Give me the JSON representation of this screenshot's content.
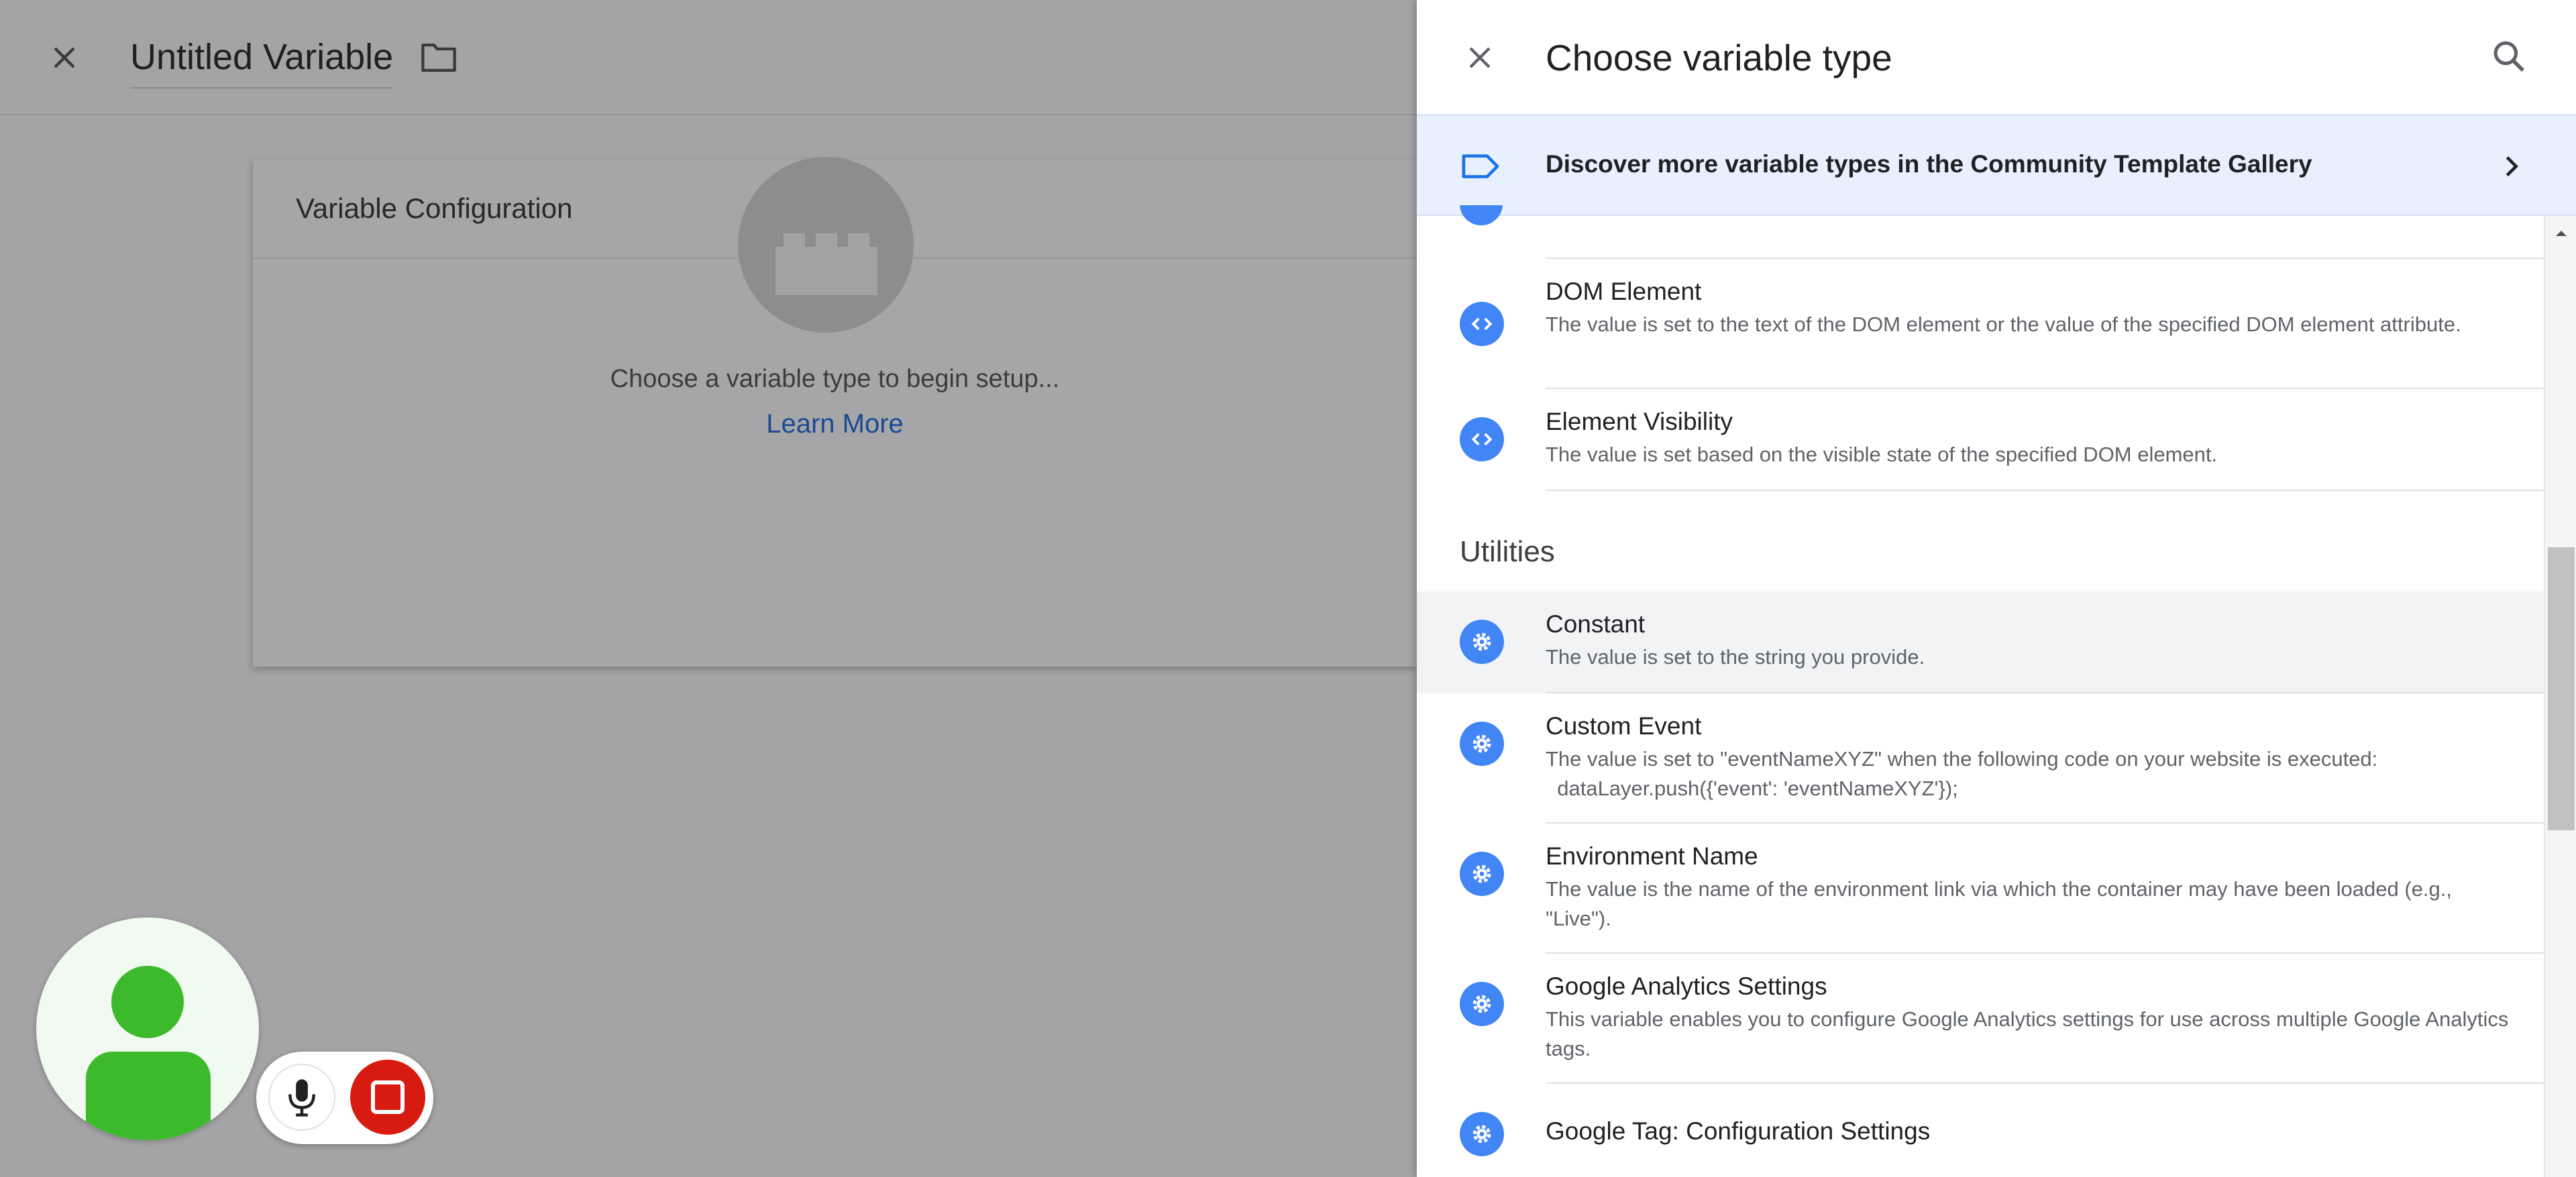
{
  "editor": {
    "title": "Untitled Variable",
    "config_card": {
      "heading": "Variable Configuration",
      "hint": "Choose a variable type to begin setup...",
      "learn_more": "Learn More"
    }
  },
  "drawer": {
    "title": "Choose variable type",
    "gallery_banner": "Discover more variable types in the Community Template Gallery",
    "page_elements_items": [
      {
        "name": "DOM Element",
        "desc": "The value is set to the text of the DOM element or the value of the specified DOM element attribute.",
        "icon": "code-icon"
      },
      {
        "name": "Element Visibility",
        "desc": "The value is set based on the visible state of the specified DOM element.",
        "icon": "code-icon"
      }
    ],
    "utilities_header": "Utilities",
    "utilities_items": [
      {
        "name": "Constant",
        "desc": "The value is set to the string you provide.",
        "icon": "gear-icon"
      },
      {
        "name": "Custom Event",
        "desc": "The value is set to \"eventNameXYZ\" when the following code on your website is executed:\n  dataLayer.push({'event': 'eventNameXYZ'});",
        "icon": "gear-icon"
      },
      {
        "name": "Environment Name",
        "desc": "The value is the name of the environment link via which the container may have been loaded (e.g., \"Live\").",
        "icon": "gear-icon"
      },
      {
        "name": "Google Analytics Settings",
        "desc": "This variable enables you to configure Google Analytics settings for use across multiple Google Analytics tags.",
        "icon": "gear-icon"
      },
      {
        "name": "Google Tag: Configuration Settings",
        "desc": "",
        "icon": "gear-icon"
      }
    ]
  },
  "colors": {
    "accent": "#4285f4",
    "banner_bg": "#e8f0fe",
    "record_red": "#d81b10",
    "avatar_green": "#3dba2c"
  }
}
